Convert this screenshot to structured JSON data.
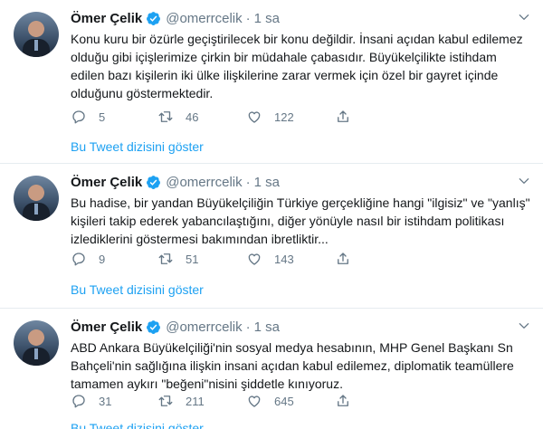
{
  "tweets": [
    {
      "name": "Ömer Çelik",
      "handle": "@omerrcelik",
      "separator": "·",
      "time": "1 sa",
      "text": "Konu kuru bir özürle geçiştirilecek bir konu değildir. İnsani açıdan kabul edilemez olduğu gibi içişlerimize çirkin bir müdahale çabasıdır. Büyükelçilikte istihdam edilen bazı kişilerin iki ülke ilişkilerine zarar vermek için özel bir gayret içinde olduğunu göstermektedir.",
      "replies": "5",
      "retweets": "46",
      "likes": "122",
      "thread_link": "Bu Tweet dizisini göster"
    },
    {
      "name": "Ömer Çelik",
      "handle": "@omerrcelik",
      "separator": "·",
      "time": "1 sa",
      "text": "Bu hadise, bir yandan Büyükelçiliğin Türkiye gerçekliğine hangi \"ilgisiz\" ve \"yanlış\" kişileri takip ederek yabancılaştığını, diğer yönüyle nasıl bir istihdam politikası izlediklerini göstermesi bakımından ibretliktir...",
      "replies": "9",
      "retweets": "51",
      "likes": "143",
      "thread_link": "Bu Tweet dizisini göster"
    },
    {
      "name": "Ömer Çelik",
      "handle": "@omerrcelik",
      "separator": "·",
      "time": "1 sa",
      "text": "ABD Ankara Büyükelçiliği'nin sosyal medya hesabının, MHP Genel Başkanı Sn Bahçeli'nin sağlığına ilişkin insani açıdan kabul edilemez, diplomatik teamüllere tamamen aykırı \"beğeni\"nisini şiddetle kınıyoruz.",
      "replies": "31",
      "retweets": "211",
      "likes": "645",
      "thread_link": "Bu Tweet dizisini göster"
    }
  ],
  "icons": {
    "verified": "verified-badge-icon",
    "caret": "chevron-down-icon",
    "reply": "reply-icon",
    "retweet": "retweet-icon",
    "like": "heart-icon",
    "share": "share-icon"
  },
  "colors": {
    "accent": "#1da1f2",
    "muted": "#657786",
    "text": "#14171a",
    "divider": "#e6ecf0"
  }
}
